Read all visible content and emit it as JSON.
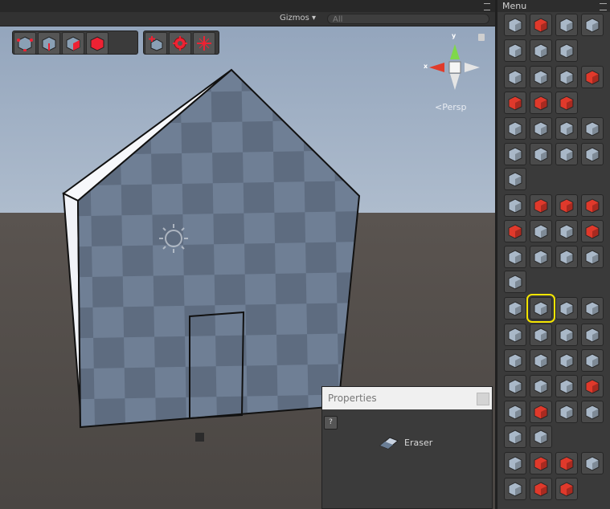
{
  "scene": {
    "toolbar": {
      "gizmos_label": "Gizmos ▾",
      "search_placeholder": "All"
    },
    "mode_buttons": [
      "vertex-mode",
      "edge-mode",
      "face-mode",
      "object-mode"
    ],
    "tool_buttons": [
      "add-block",
      "settings",
      "center-pivot"
    ],
    "persp_label": "Persp",
    "axis_x": "x",
    "axis_y": "y"
  },
  "panel": {
    "title": "Menu",
    "selected_tool": "eraser",
    "tools": [
      "cube-pointer",
      "red-gem",
      "stack-cube",
      "stack-blocks",
      "pillar",
      "cube-outline",
      "crystal",
      "pen",
      "line",
      "arc",
      "rect-slash",
      "torus-red",
      "ramp-red",
      "bars-red",
      "cube-sphere-mix",
      "cube",
      "cube-small",
      "stairs",
      "cylinder",
      "cone",
      "circular-grid",
      "sphere",
      "capsule",
      "cube-point",
      "arrow-extrude",
      "arrow-push",
      "arrow-pull",
      "scale-red",
      "split-cube",
      "box-split",
      "cube-corner",
      "curve",
      "cube-wide",
      "half-box",
      "grid-cubes",
      "cube-flat",
      "eraser-small",
      "eraser",
      "bounds",
      "select-box",
      "slice-a",
      "slice-b",
      "slice-c",
      "pillar-dark",
      "rotate",
      "plane-flip",
      "cylinder-cut",
      "arrows-scale",
      "move-cube",
      "axes",
      "plane-axes",
      "red-arrow",
      "grid-block",
      "red-block",
      "tiles",
      "boolean",
      "cube-drag",
      "tall-cylinder",
      "grid-square",
      "cube-plus",
      "refresh",
      "cube-twist",
      "cube-copy",
      "export",
      "gear-red"
    ]
  },
  "properties": {
    "title": "Properties",
    "help_label": "?",
    "tool_name": "Eraser"
  }
}
